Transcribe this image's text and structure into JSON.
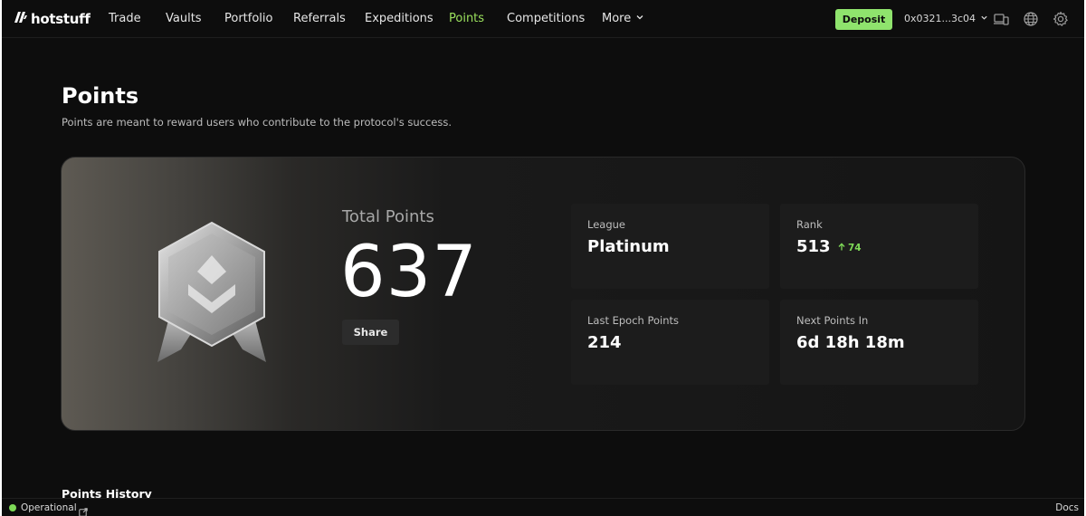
{
  "brand": {
    "name": "hotstuff",
    "logo_icon": "brand-logo-icon"
  },
  "nav": {
    "items": [
      {
        "label": "Trade"
      },
      {
        "label": "Vaults"
      },
      {
        "label": "Portfolio"
      },
      {
        "label": "Referrals"
      },
      {
        "label": "Expeditions"
      },
      {
        "label": "Points",
        "active": true
      },
      {
        "label": "Competitions"
      }
    ],
    "more_label": "More",
    "deposit_label": "Deposit",
    "wallet_address": "0x0321...3c04",
    "icons": [
      "devices-icon",
      "globe-icon",
      "gear-icon"
    ]
  },
  "header": {
    "title": "Points",
    "subtitle": "Points are meant to reward users who contribute to the protocol's success."
  },
  "hero": {
    "total_label": "Total Points",
    "total_value": "637",
    "share_label": "Share",
    "badge_icon": "platinum-badge-icon",
    "stats": {
      "league": {
        "label": "League",
        "value": "Platinum"
      },
      "rank": {
        "label": "Rank",
        "value": "513",
        "change": "74",
        "change_direction": "up"
      },
      "last_epoch": {
        "label": "Last Epoch Points",
        "value": "214"
      },
      "next_points": {
        "label": "Next Points In",
        "value": "6d 18h 18m"
      }
    }
  },
  "history": {
    "title": "Points History"
  },
  "footer": {
    "status": "Operational",
    "status_color": "#7ed957",
    "docs_label": "Docs"
  },
  "colors": {
    "accent_green": "#8fe36d",
    "active_nav": "#9be15d",
    "background": "#0d0d0d",
    "card": "#1c1c1c"
  }
}
